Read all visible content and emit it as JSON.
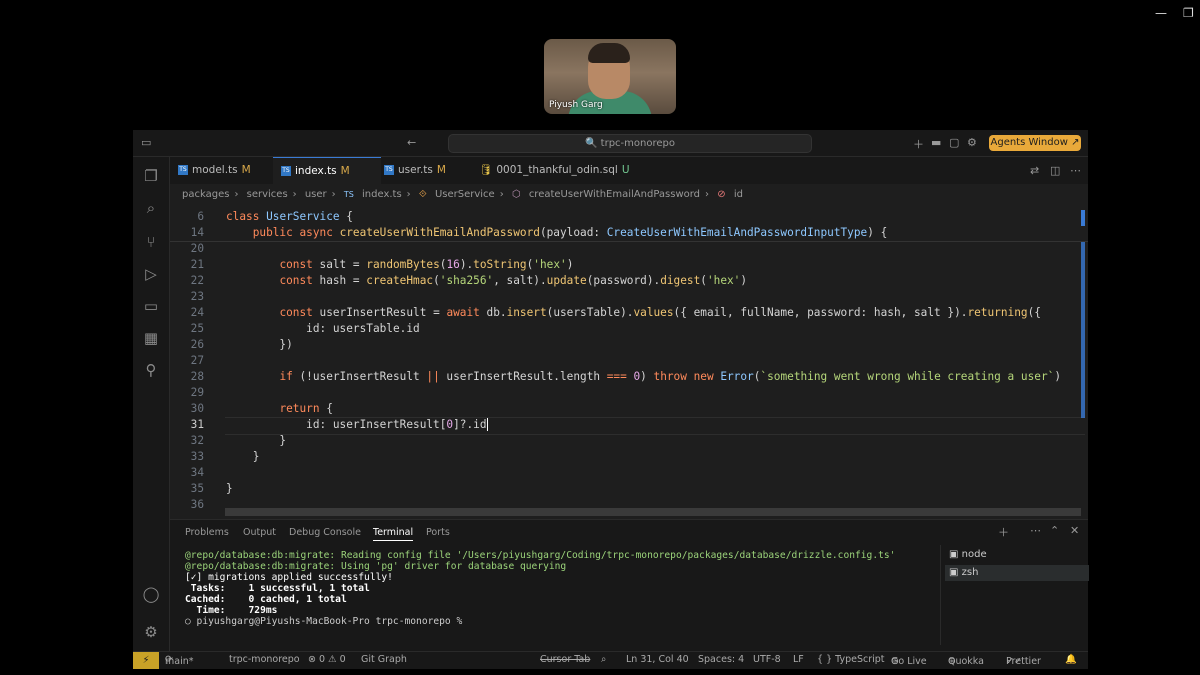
{
  "window_controls": {
    "minimize": "—",
    "restore": "❐"
  },
  "video": {
    "participant_name": "Piyush Garg"
  },
  "titlebar": {
    "search_placeholder": "trpc-monorepo",
    "agents_button": "Agents Window ↗"
  },
  "tabs": [
    {
      "label": "model.ts",
      "badge": "M"
    },
    {
      "label": "index.ts",
      "badge": "M"
    },
    {
      "label": "user.ts",
      "badge": "M"
    },
    {
      "label": "0001_thankful_odin.sql",
      "badge": "U"
    }
  ],
  "breadcrumb": [
    "packages",
    "services",
    "user",
    "index.ts",
    "UserService",
    "createUserWithEmailAndPassword",
    "id"
  ],
  "line_numbers": [
    "6",
    "14",
    "20",
    "21",
    "22",
    "23",
    "24",
    "25",
    "26",
    "27",
    "28",
    "29",
    "30",
    "31",
    "32",
    "33",
    "34",
    "35",
    "36"
  ],
  "panel": {
    "tabs": [
      "Problems",
      "Output",
      "Debug Console",
      "Terminal",
      "Ports"
    ],
    "terminal_lines": [
      "@repo/database:db:migrate: Reading config file '/Users/piyushgarg/Coding/trpc-monorepo/packages/database/drizzle.config.ts'",
      "@repo/database:db:migrate: Using 'pg' driver for database querying",
      "[✓] migrations applied successfully!",
      "",
      " Tasks:    1 successful, 1 total",
      "Cached:    0 cached, 1 total",
      "  Time:    729ms",
      "",
      "",
      "○ piyushgarg@Piyushs-MacBook-Pro trpc-monorepo % "
    ],
    "terminal_list": [
      "node",
      "zsh"
    ]
  },
  "statusbar": {
    "branch": "main*",
    "repo": "trpc-monorepo",
    "problems": "⊗ 0  ⚠ 0",
    "git_graph": "Git Graph",
    "cursor_tab": "Cursor Tab",
    "position": "Ln 31, Col 40",
    "spaces": "Spaces: 4",
    "encoding": "UTF-8",
    "eol": "LF",
    "language": "{ } TypeScript",
    "golive": "Go Live",
    "quokka": "Quokka",
    "prettier": "Prettier"
  }
}
